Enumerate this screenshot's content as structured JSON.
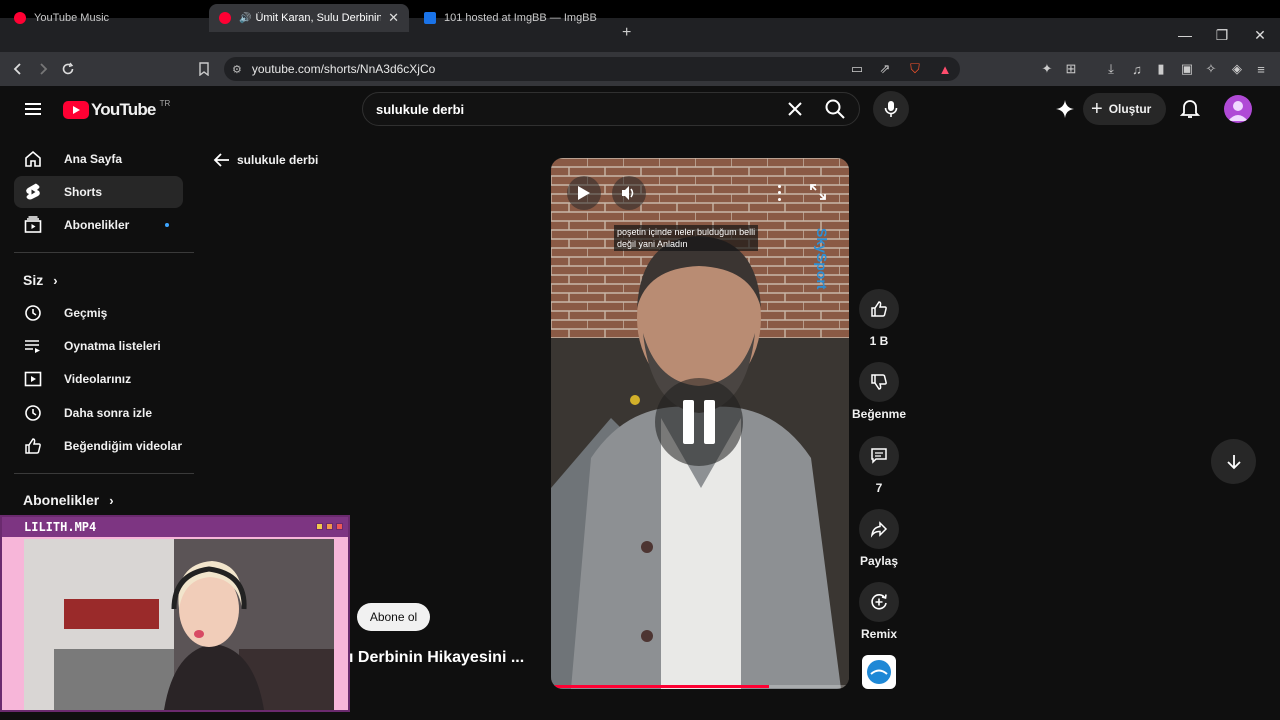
{
  "browser": {
    "tabs": [
      {
        "label": "YouTube Music",
        "favicon_color": "#ff0033"
      },
      {
        "label": "Ümit Karan, Sulu Derbinin Hik",
        "favicon_color": "#ff0033"
      },
      {
        "label": "101 hosted at ImgBB — ImgBB",
        "favicon_color": "#1a73e8"
      }
    ],
    "new_tab": "+",
    "window_controls": {
      "minimize": "—",
      "maximize": "❐",
      "close": "✕"
    },
    "url": "youtube.com/shorts/NnA3d6cXjCo"
  },
  "youtube": {
    "logo_text": "YouTube",
    "region": "TR",
    "search": {
      "value": "sulukule derbi"
    },
    "create_label": "Oluştur",
    "back_label": "sulukule derbi",
    "sidebar": {
      "items": [
        {
          "label": "Ana Sayfa",
          "icon": "home-icon"
        },
        {
          "label": "Shorts",
          "icon": "shorts-icon"
        },
        {
          "label": "Abonelikler",
          "icon": "subscriptions-icon"
        }
      ],
      "you_section": "Siz",
      "you_items": [
        {
          "label": "Geçmiş",
          "icon": "history-icon"
        },
        {
          "label": "Oynatma listeleri",
          "icon": "playlists-icon"
        },
        {
          "label": "Videolarınız",
          "icon": "your-videos-icon"
        },
        {
          "label": "Daha sonra izle",
          "icon": "watch-later-icon"
        },
        {
          "label": "Beğendiğim videolar",
          "icon": "liked-icon"
        }
      ],
      "subs_section": "Abonelikler"
    },
    "short": {
      "caption_line1": "poşetin içinde neler bulduğum belli",
      "caption_line2": "değil yani Anladın",
      "watermark": "SkySport",
      "title_partial": "ı Derbinin Hikayesini ...",
      "subscribe_label": "Abone ol",
      "progress": 0.73
    },
    "actions": {
      "like_count": "1 B",
      "dislike_label": "Beğenme",
      "comments_count": "7",
      "share_label": "Paylaş",
      "remix_label": "Remix"
    }
  },
  "overlay": {
    "title": "LILITH.MP4"
  }
}
